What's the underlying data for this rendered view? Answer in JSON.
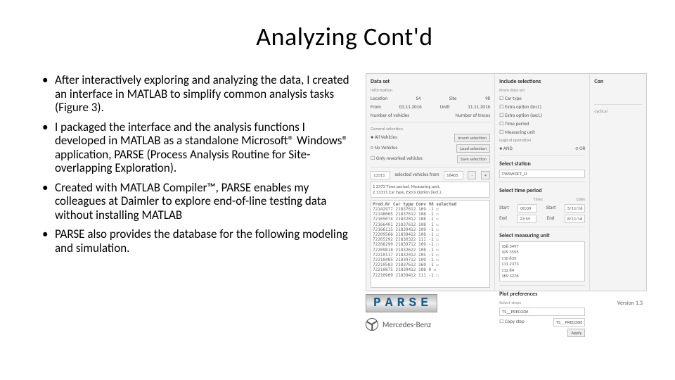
{
  "title": "Analyzing Cont'd",
  "bullets": [
    "After interactively exploring and analyzing the data, I created an interface in MATLAB to simplify common analysis tasks (Figure 3).",
    " I packaged the interface and the analysis functions I developed in MATLAB as a standalone Microsoft® Windows® application, PARSE (Process Analysis Routine for Site-overlapping Exploration).",
    "Created with MATLAB Compiler™, PARSE enables my colleagues at Daimler to explore end-of-line testing data without installing MATLAB",
    "PARSE also provides the database for the following modeling and simulation."
  ],
  "gui": {
    "dataset": {
      "header": "Data set",
      "info_header": "Information",
      "location_label": "Location",
      "location_value": "S4",
      "site_label": "Site",
      "site_value": "98",
      "from_label": "From",
      "from_value": "03.11.2016",
      "until_label": "Until",
      "until_value": "11.11.2016",
      "nveh_label": "Number of vehicles",
      "ntraces_label": "Number of traces"
    },
    "general_selection": {
      "header": "General selection",
      "r1": "All Vehicles",
      "r2": "No Vehicles",
      "chk": "Only reworked vehicles",
      "b1": "Invert selection",
      "b2": "Load selection",
      "b3": "Save selection"
    },
    "sel_bar": {
      "count1": "13311",
      "mid": "selected vehicles from",
      "count2": "16405"
    },
    "sel_rows": [
      "1  2373 Time period, Measuring unit,",
      "2  13311 Car type, Extra Option (incl.),"
    ],
    "table_header": "Prod.Nr    Car type    Conv  98  selected",
    "table_rows": [
      "72142977  21837612  169  -1  ☐",
      "72148065  21837612  108  -1  ☐",
      "72165074  21832012  108  -1  ☐",
      "72166401  21837612  108  -1  ☐",
      "72166115  21839412  109  -1  ☐",
      "72209566  21839412  108  -1  ☐",
      "72205292  21830322  111  -1  ☐",
      "72208299  21839712  109  -1  ☐",
      "72209818  21832622  108  -1  ☐",
      "72210117  21832012  105  -1  ☐",
      "72210485  21839712  109  -1  ☐",
      "72210503  21837612  169  -1  ☐",
      "72210875  21839412  108  0   ☐",
      "72210909  21839412  111  -1  ☐"
    ],
    "include": {
      "header": "Include selections",
      "from_label": "From data set",
      "i1": "Car type",
      "i2": "Extra option (incl.)",
      "i3": "Extra option (excl.)",
      "i4": "Time period",
      "i5": "Measuring unit",
      "logic_label": "Logical operation",
      "and": "AND",
      "or": "OR"
    },
    "station": {
      "header": "Select station",
      "value": "FWSWOFT_LI"
    },
    "time": {
      "header": "Select time period",
      "time_col": "Time",
      "date_col": "Date",
      "start": "Start",
      "start_t": "00:00",
      "start_d": "5/11/16",
      "end": "End",
      "end_t": "23:59",
      "end_d": "8/11/16"
    },
    "measuring": {
      "header": "Select measuring unit",
      "rows": [
        "108  3497",
        "109  3595",
        "110  835",
        "111  2373",
        "112  84",
        "169  3276"
      ]
    },
    "plot": {
      "header": "Plot preferences",
      "label": "Select steps",
      "v1": "TS__PRECODE",
      "chk": "Copy step",
      "v2": "TS__PRECODE",
      "apply": "Apply"
    },
    "con": {
      "header": "Con",
      "cyclical": "cyclical"
    },
    "parse_logo": "PARSE",
    "version": "Version 1.3",
    "brand": "Mercedes-Benz"
  }
}
